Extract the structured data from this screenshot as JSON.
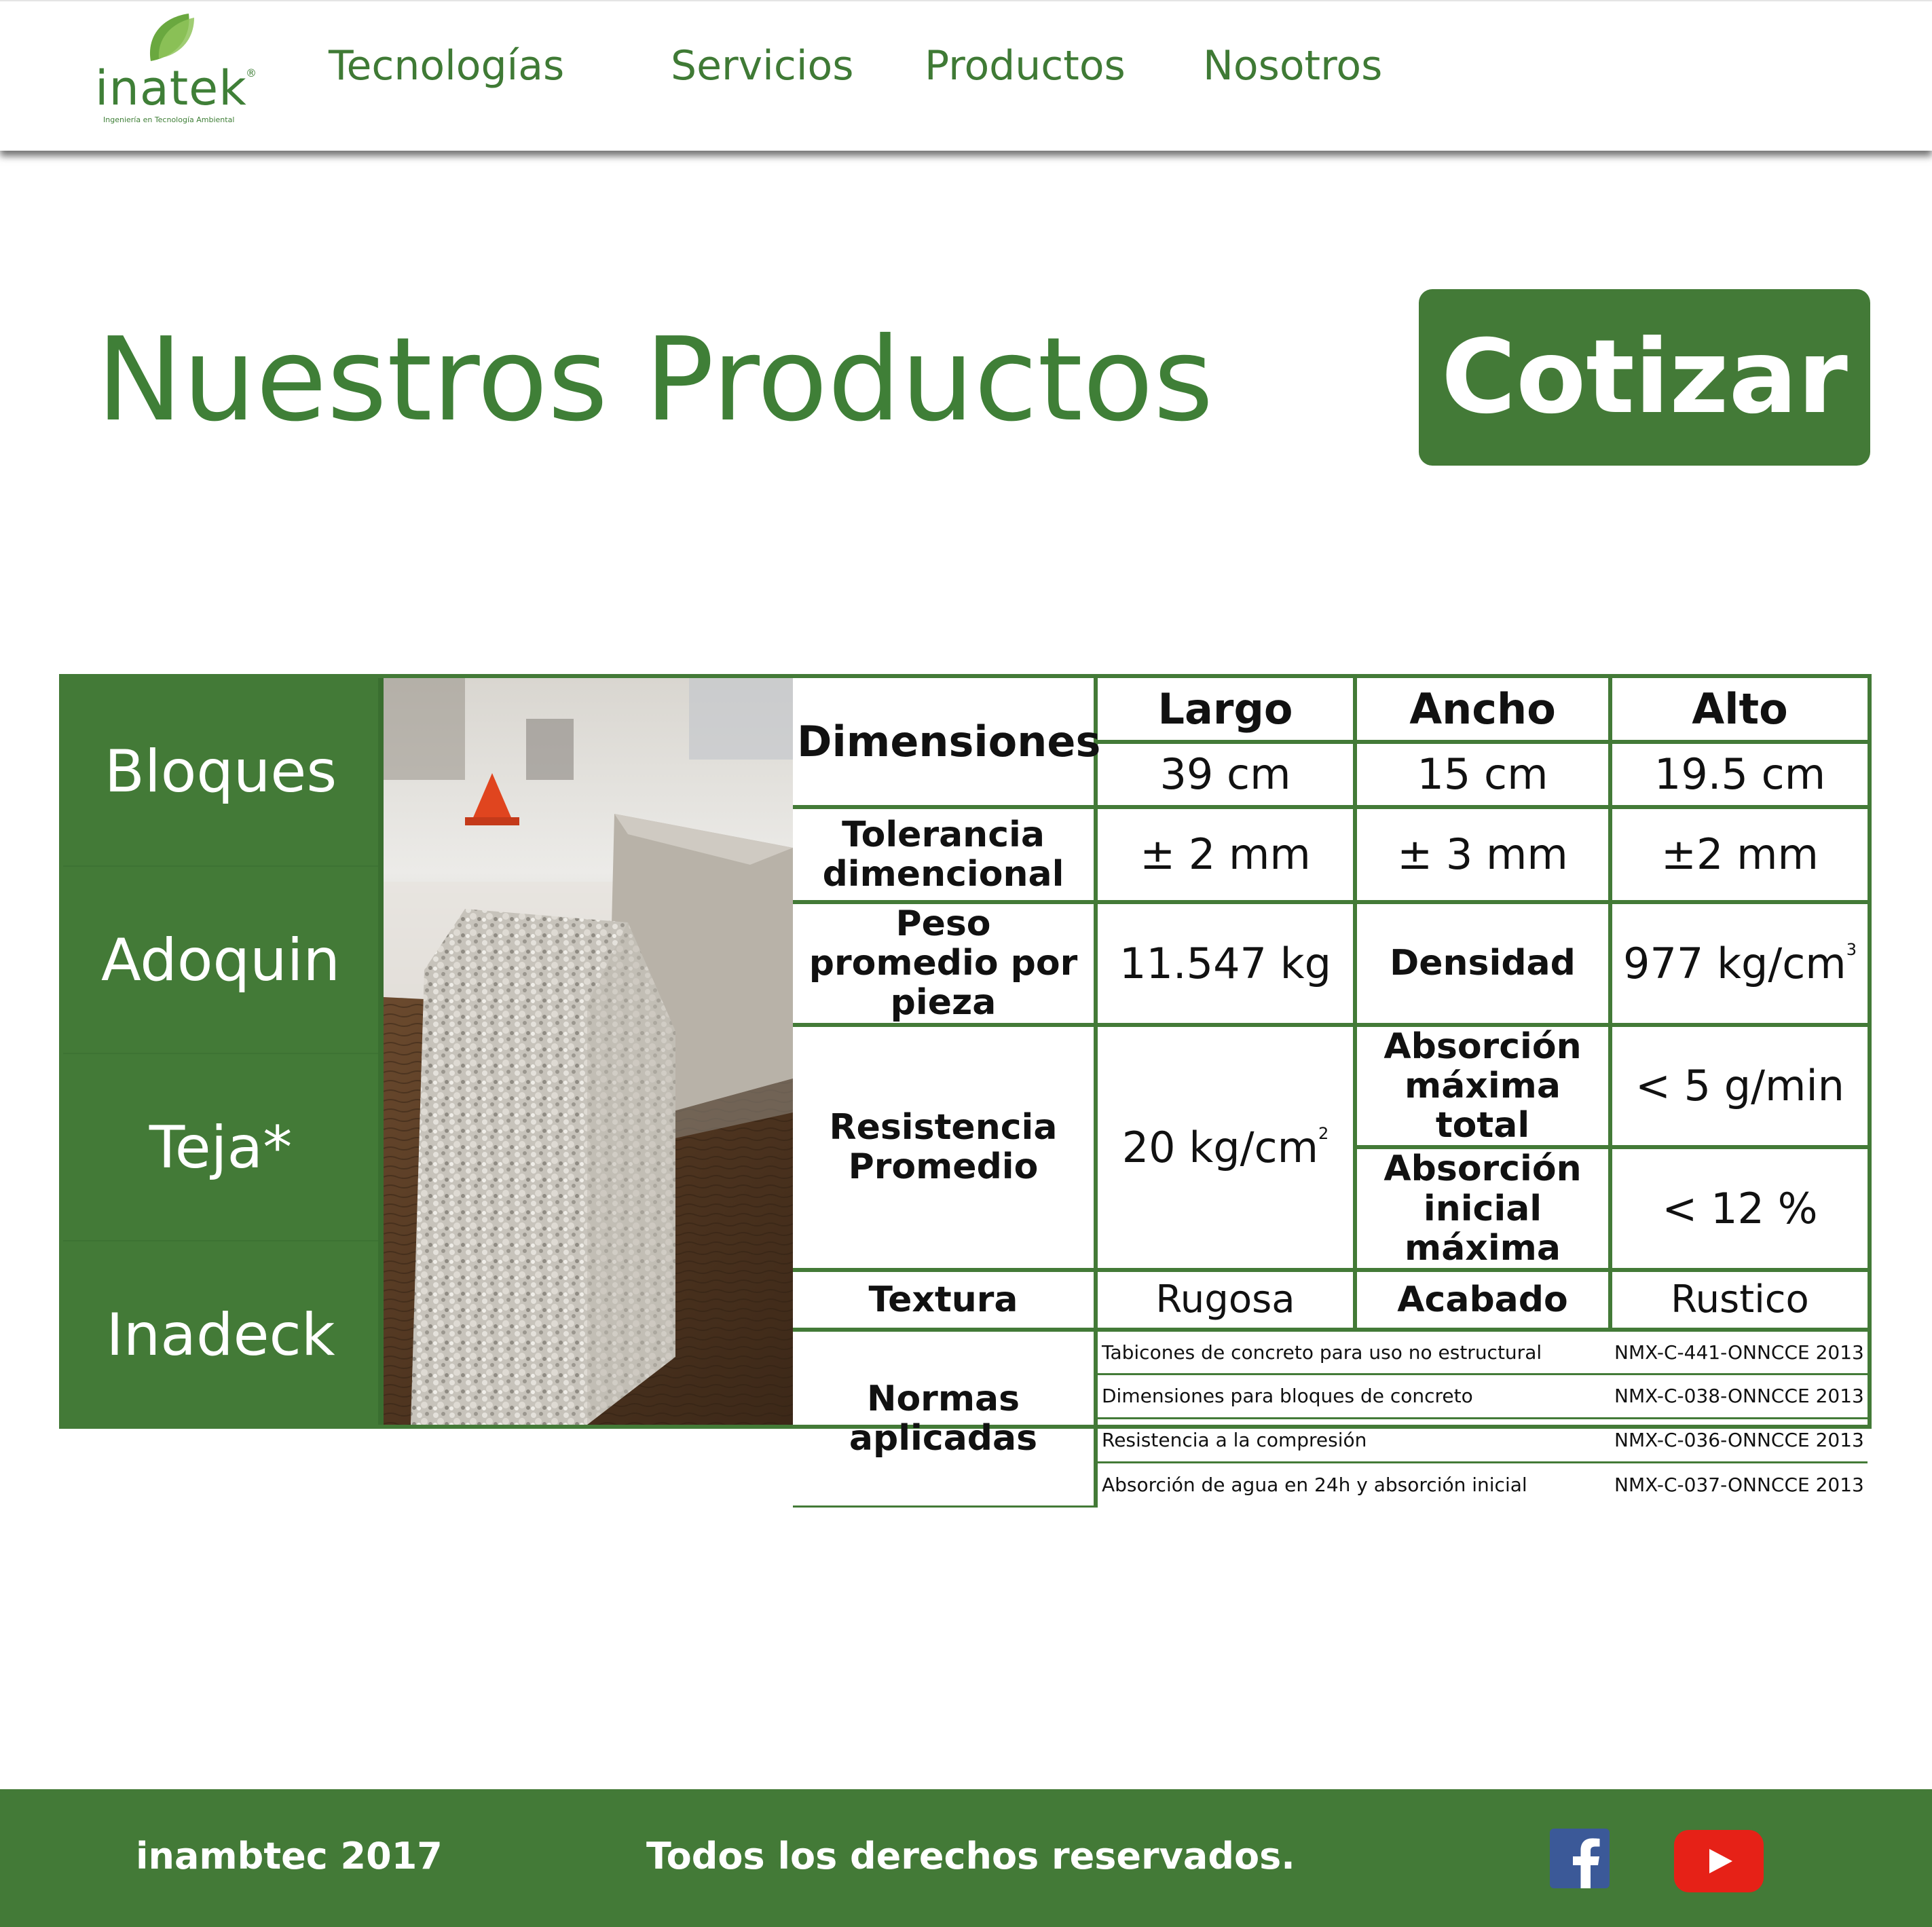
{
  "brand": {
    "name": "inatek",
    "registered": "®",
    "tagline": "Ingeniería en Tecnología Ambiental"
  },
  "nav": {
    "items": [
      {
        "label": "Tecnologías"
      },
      {
        "label": "Servicios"
      },
      {
        "label": "Productos"
      },
      {
        "label": "Nosotros"
      }
    ]
  },
  "main": {
    "title": "Nuestros Productos",
    "cta_label": "Cotizar"
  },
  "categories": [
    "Bloques",
    "Adoquin",
    "Teja*",
    "Inadeck"
  ],
  "specs": {
    "dimensiones_label": "Dimensiones",
    "headers": [
      "Largo",
      "Ancho",
      "Alto"
    ],
    "dimensiones": [
      "39 cm",
      "15 cm",
      "19.5 cm"
    ],
    "tolerancia_label": "Tolerancia dimencional",
    "tolerancia": [
      "± 2 mm",
      "± 3 mm",
      "±2 mm"
    ],
    "peso_label": "Peso promedio por pieza",
    "peso": "11.547 kg",
    "densidad_label": "Densidad",
    "densidad": "977 kg/cm",
    "densidad_exp": "3",
    "resistencia_label": "Resistencia Promedio",
    "resistencia": "20 kg/cm",
    "resistencia_exp": "2",
    "absorcion_total_label": "Absorción máxima total",
    "absorcion_total": "< 5 g/min",
    "absorcion_inicial_label": "Absorción inicial máxima",
    "absorcion_inicial": "< 12 %",
    "textura_label": "Textura",
    "textura": "Rugosa",
    "acabado_label": "Acabado",
    "acabado": "Rustico",
    "normas_label": "Normas aplicadas",
    "normas": [
      {
        "name": "Tabicones de concreto para uso no estructural",
        "code": "NMX-C-441-ONNCCE 2013"
      },
      {
        "name": "Dimensiones para bloques de concreto",
        "code": "NMX-C-038-ONNCCE 2013"
      },
      {
        "name": "Resistencia a la compresión",
        "code": "NMX-C-036-ONNCCE 2013"
      },
      {
        "name": "Absorción de agua en 24h y absorción inicial",
        "code": "NMX-C-037-ONNCCE 2013"
      }
    ]
  },
  "footer": {
    "company": "inambtec 2017",
    "rights": "Todos los derechos reservados."
  },
  "colors": {
    "brand_green": "#437a37",
    "text_green": "#3f7f37",
    "facebook": "#3b5998",
    "youtube": "#e62117"
  },
  "icons": [
    "leaf-logo-icon",
    "facebook-icon",
    "youtube-icon"
  ]
}
